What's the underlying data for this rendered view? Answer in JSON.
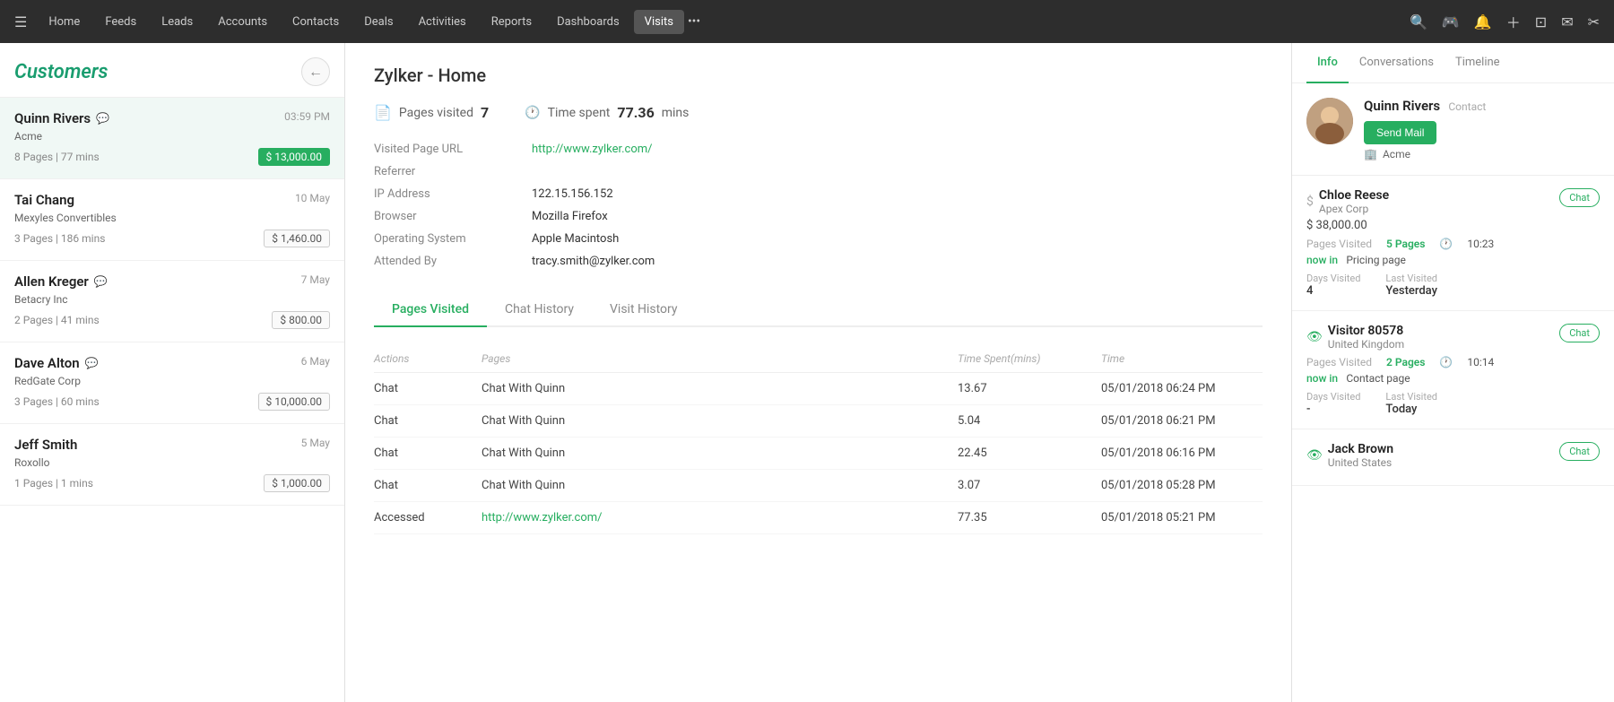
{
  "nav": {
    "hamburger": "☰",
    "items": [
      {
        "label": "Home",
        "active": false
      },
      {
        "label": "Feeds",
        "active": false
      },
      {
        "label": "Leads",
        "active": false
      },
      {
        "label": "Accounts",
        "active": false
      },
      {
        "label": "Contacts",
        "active": false
      },
      {
        "label": "Deals",
        "active": false
      },
      {
        "label": "Activities",
        "active": false
      },
      {
        "label": "Reports",
        "active": false
      },
      {
        "label": "Dashboards",
        "active": false
      },
      {
        "label": "Visits",
        "active": true
      }
    ],
    "more": "•••",
    "icons": [
      "🔍",
      "🎮",
      "🔔",
      "+",
      "⊡",
      "✉",
      "✂"
    ]
  },
  "sidebar": {
    "title": "Customers",
    "back_icon": "←",
    "customers": [
      {
        "name": "Quinn Rivers",
        "icon": "💬",
        "time": "03:59 PM",
        "company": "Acme",
        "stats": "8 Pages  |  77 mins",
        "value": "$ 13,000.00",
        "value_green": true,
        "active": true
      },
      {
        "name": "Tai Chang",
        "icon": "",
        "time": "10 May",
        "company": "Mexyles Convertibles",
        "stats": "3 Pages  |  186 mins",
        "value": "$ 1,460.00",
        "value_green": false
      },
      {
        "name": "Allen Kreger",
        "icon": "💬",
        "time": "7 May",
        "company": "Betacry Inc",
        "stats": "2 Pages  |  41 mins",
        "value": "$ 800.00",
        "value_green": false
      },
      {
        "name": "Dave Alton",
        "icon": "💬",
        "time": "6 May",
        "company": "RedGate Corp",
        "stats": "3 Pages  |  60 mins",
        "value": "$ 10,000.00",
        "value_green": false
      },
      {
        "name": "Jeff Smith",
        "icon": "",
        "time": "5 May",
        "company": "Roxollo",
        "stats": "1 Pages  |  1 mins",
        "value": "$ 1,000.00",
        "value_green": false
      }
    ]
  },
  "main": {
    "page_title": "Zylker - Home",
    "stats": {
      "pages_label": "Pages visited",
      "pages_value": "7",
      "time_label": "Time spent",
      "time_value": "77.36",
      "time_unit": "mins"
    },
    "details": {
      "visited_url_label": "Visited Page URL",
      "visited_url_value": "http://www.zylker.com/",
      "referrer_label": "Referrer",
      "referrer_value": "",
      "ip_label": "IP Address",
      "ip_value": "122.15.156.152",
      "browser_label": "Browser",
      "browser_value": "Mozilla Firefox",
      "os_label": "Operating System",
      "os_value": "Apple Macintosh",
      "attended_label": "Attended By",
      "attended_value": "tracy.smith@zylker.com"
    },
    "tabs": [
      {
        "label": "Pages Visited",
        "active": true
      },
      {
        "label": "Chat History",
        "active": false
      },
      {
        "label": "Visit History",
        "active": false
      }
    ],
    "table": {
      "headers": [
        "Actions",
        "Pages",
        "Time Spent(mins)",
        "Time"
      ],
      "rows": [
        {
          "action": "Chat",
          "page": "Chat With Quinn",
          "time_spent": "13.67",
          "time": "05/01/2018 06:24 PM"
        },
        {
          "action": "Chat",
          "page": "Chat With Quinn",
          "time_spent": "5.04",
          "time": "05/01/2018 06:21 PM"
        },
        {
          "action": "Chat",
          "page": "Chat With Quinn",
          "time_spent": "22.45",
          "time": "05/01/2018 06:16 PM"
        },
        {
          "action": "Chat",
          "page": "Chat With Quinn",
          "time_spent": "3.07",
          "time": "05/01/2018 05:28 PM"
        },
        {
          "action": "Accessed",
          "page": "http://www.zylker.com/",
          "time_spent": "77.35",
          "time": "05/01/2018 05:21 PM",
          "is_link": true
        }
      ]
    }
  },
  "right_panel": {
    "tabs": [
      "Info",
      "Conversations",
      "Timeline"
    ],
    "active_tab": "Info",
    "contact": {
      "name": "Quinn Rivers",
      "type": "Contact",
      "send_mail": "Send Mail",
      "company": "Acme"
    },
    "visitors": [
      {
        "name": "Chloe Reese",
        "country": "Apex Corp",
        "amount": "$ 38,000.00",
        "pages_label": "Pages Visited",
        "pages_value": "5 Pages",
        "time": "10:23",
        "now_label": "now in",
        "now_page": "Pricing page",
        "days_visited_label": "Days Visited",
        "days_visited_value": "4",
        "last_visited_label": "Last Visited",
        "last_visited_value": "Yesterday",
        "chat_label": "Chat",
        "is_green_icon": false
      },
      {
        "name": "Visitor 80578",
        "country": "United Kingdom",
        "amount": "",
        "pages_label": "Pages Visited",
        "pages_value": "2 Pages",
        "time": "10:14",
        "now_label": "now in",
        "now_page": "Contact page",
        "days_visited_label": "Days Visited",
        "days_visited_value": "-",
        "last_visited_label": "Last Visited",
        "last_visited_value": "Today",
        "chat_label": "Chat",
        "is_green_icon": true
      },
      {
        "name": "Jack Brown",
        "country": "United States",
        "amount": "",
        "pages_label": "",
        "pages_value": "",
        "time": "",
        "now_label": "",
        "now_page": "",
        "days_visited_label": "",
        "days_visited_value": "",
        "last_visited_label": "",
        "last_visited_value": "",
        "chat_label": "Chat",
        "is_green_icon": true
      }
    ]
  },
  "colors": {
    "green": "#27ae60",
    "nav_bg": "#2d2d2d",
    "accent": "#1a9d6f"
  }
}
